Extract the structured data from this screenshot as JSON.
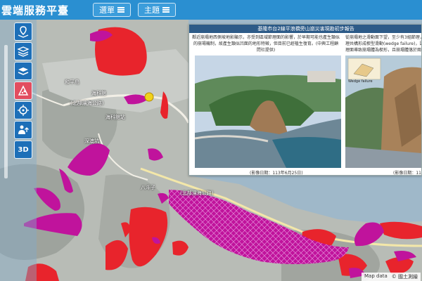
{
  "app": {
    "title": "雲端服務平臺",
    "menu_label": "選單",
    "topic_label": "主題"
  },
  "sidebar": {
    "tools": [
      {
        "icon": "map-pin-layers-icon"
      },
      {
        "icon": "map-layers-icon"
      },
      {
        "icon": "layers-stack-icon"
      },
      {
        "icon": "rockfall-hazard-icon",
        "active": true
      },
      {
        "icon": "location-target-icon"
      },
      {
        "icon": "person-upload-icon"
      },
      {
        "icon": "3d-view-icon",
        "label": "3D"
      }
    ]
  },
  "report": {
    "title": "基隆市台2線平浪橋旁山崩災害現勘初步報告",
    "desc_left": "鄰近崩塌地西側坡地影顯示，亦受到區域節理面的影響，於早期可能也產生類似的崩場機制，故產生類似凹面的地形特徵，但目前已經植生復育。(中興工程顧問社提供)",
    "desc_right": "從崩塌地之滑動面下望，至少有3組節理，且各節理共構形成楔型滑動(wedge failure)，因2組節理面導致崩塌體為楔形，且崩塌體落於兩線道路",
    "caption_left": "(影像日期：113年6月25日)",
    "caption_right": "(影像日期：113年",
    "wedge_label": "Wedge failure"
  },
  "map_labels": {
    "road": "中山一路",
    "bridge": "平浪橋",
    "road_a": "(北部濱海公路)",
    "village": "和平島",
    "school": "長潭國小",
    "park": "海科館",
    "coast": "八斗子漁港",
    "highway": "台2線",
    "hill": "深澳坑",
    "station": "海科館站",
    "road_b": "北寧路",
    "area": "八斗子",
    "trail": "(北部濱海公路)"
  },
  "attribution": {
    "map_data": "Map data",
    "source": "© 國土測繪"
  },
  "colors": {
    "topbar": "#2a8fd1",
    "hazard_red": "#e8242c",
    "hazard_magenta": "#c0139c",
    "sea": "#9fb8c9",
    "report_header": "#2d5b88"
  }
}
